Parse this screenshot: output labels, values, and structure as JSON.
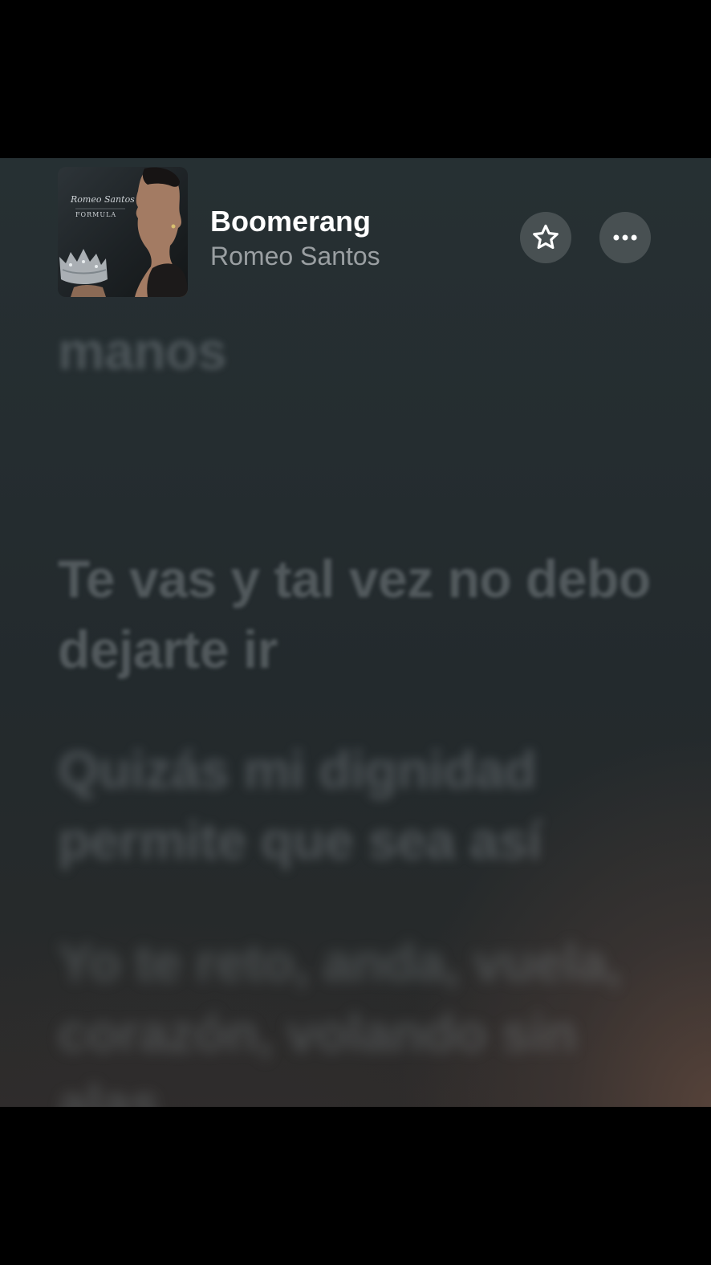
{
  "now_playing": {
    "title": "Boomerang",
    "artist": "Romeo Santos",
    "album_art_text": "Romeo Santos FORMULA"
  },
  "actions": {
    "favorite_icon": "star-icon",
    "more_icon": "ellipsis-icon"
  },
  "lyrics": {
    "previous_line": "manos",
    "current_line": "Te vas y tal vez no debo dejarte ir",
    "next_line": "Quizás mi dignidad permite que sea así",
    "following_line": "Yo te reto, anda, vuela, corazón, volando sin alas"
  },
  "colors": {
    "title": "#ffffff",
    "artist": "#9a9fa2",
    "panel_background": "#252d30",
    "button_background": "#4a5154"
  }
}
